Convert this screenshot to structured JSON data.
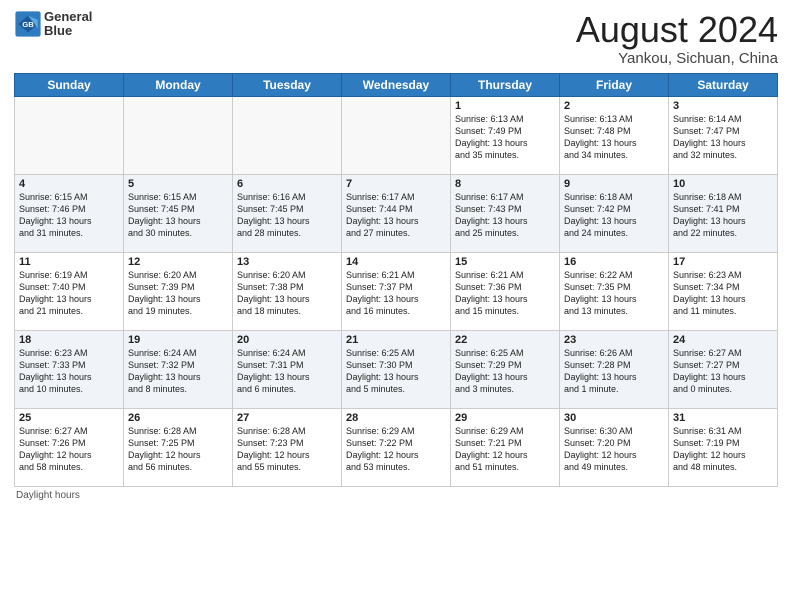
{
  "header": {
    "logo_line1": "General",
    "logo_line2": "Blue",
    "main_title": "August 2024",
    "subtitle": "Yankou, Sichuan, China"
  },
  "weekdays": [
    "Sunday",
    "Monday",
    "Tuesday",
    "Wednesday",
    "Thursday",
    "Friday",
    "Saturday"
  ],
  "weeks": [
    [
      {
        "day": "",
        "info": ""
      },
      {
        "day": "",
        "info": ""
      },
      {
        "day": "",
        "info": ""
      },
      {
        "day": "",
        "info": ""
      },
      {
        "day": "1",
        "info": "Sunrise: 6:13 AM\nSunset: 7:49 PM\nDaylight: 13 hours\nand 35 minutes."
      },
      {
        "day": "2",
        "info": "Sunrise: 6:13 AM\nSunset: 7:48 PM\nDaylight: 13 hours\nand 34 minutes."
      },
      {
        "day": "3",
        "info": "Sunrise: 6:14 AM\nSunset: 7:47 PM\nDaylight: 13 hours\nand 32 minutes."
      }
    ],
    [
      {
        "day": "4",
        "info": "Sunrise: 6:15 AM\nSunset: 7:46 PM\nDaylight: 13 hours\nand 31 minutes."
      },
      {
        "day": "5",
        "info": "Sunrise: 6:15 AM\nSunset: 7:45 PM\nDaylight: 13 hours\nand 30 minutes."
      },
      {
        "day": "6",
        "info": "Sunrise: 6:16 AM\nSunset: 7:45 PM\nDaylight: 13 hours\nand 28 minutes."
      },
      {
        "day": "7",
        "info": "Sunrise: 6:17 AM\nSunset: 7:44 PM\nDaylight: 13 hours\nand 27 minutes."
      },
      {
        "day": "8",
        "info": "Sunrise: 6:17 AM\nSunset: 7:43 PM\nDaylight: 13 hours\nand 25 minutes."
      },
      {
        "day": "9",
        "info": "Sunrise: 6:18 AM\nSunset: 7:42 PM\nDaylight: 13 hours\nand 24 minutes."
      },
      {
        "day": "10",
        "info": "Sunrise: 6:18 AM\nSunset: 7:41 PM\nDaylight: 13 hours\nand 22 minutes."
      }
    ],
    [
      {
        "day": "11",
        "info": "Sunrise: 6:19 AM\nSunset: 7:40 PM\nDaylight: 13 hours\nand 21 minutes."
      },
      {
        "day": "12",
        "info": "Sunrise: 6:20 AM\nSunset: 7:39 PM\nDaylight: 13 hours\nand 19 minutes."
      },
      {
        "day": "13",
        "info": "Sunrise: 6:20 AM\nSunset: 7:38 PM\nDaylight: 13 hours\nand 18 minutes."
      },
      {
        "day": "14",
        "info": "Sunrise: 6:21 AM\nSunset: 7:37 PM\nDaylight: 13 hours\nand 16 minutes."
      },
      {
        "day": "15",
        "info": "Sunrise: 6:21 AM\nSunset: 7:36 PM\nDaylight: 13 hours\nand 15 minutes."
      },
      {
        "day": "16",
        "info": "Sunrise: 6:22 AM\nSunset: 7:35 PM\nDaylight: 13 hours\nand 13 minutes."
      },
      {
        "day": "17",
        "info": "Sunrise: 6:23 AM\nSunset: 7:34 PM\nDaylight: 13 hours\nand 11 minutes."
      }
    ],
    [
      {
        "day": "18",
        "info": "Sunrise: 6:23 AM\nSunset: 7:33 PM\nDaylight: 13 hours\nand 10 minutes."
      },
      {
        "day": "19",
        "info": "Sunrise: 6:24 AM\nSunset: 7:32 PM\nDaylight: 13 hours\nand 8 minutes."
      },
      {
        "day": "20",
        "info": "Sunrise: 6:24 AM\nSunset: 7:31 PM\nDaylight: 13 hours\nand 6 minutes."
      },
      {
        "day": "21",
        "info": "Sunrise: 6:25 AM\nSunset: 7:30 PM\nDaylight: 13 hours\nand 5 minutes."
      },
      {
        "day": "22",
        "info": "Sunrise: 6:25 AM\nSunset: 7:29 PM\nDaylight: 13 hours\nand 3 minutes."
      },
      {
        "day": "23",
        "info": "Sunrise: 6:26 AM\nSunset: 7:28 PM\nDaylight: 13 hours\nand 1 minute."
      },
      {
        "day": "24",
        "info": "Sunrise: 6:27 AM\nSunset: 7:27 PM\nDaylight: 13 hours\nand 0 minutes."
      }
    ],
    [
      {
        "day": "25",
        "info": "Sunrise: 6:27 AM\nSunset: 7:26 PM\nDaylight: 12 hours\nand 58 minutes."
      },
      {
        "day": "26",
        "info": "Sunrise: 6:28 AM\nSunset: 7:25 PM\nDaylight: 12 hours\nand 56 minutes."
      },
      {
        "day": "27",
        "info": "Sunrise: 6:28 AM\nSunset: 7:23 PM\nDaylight: 12 hours\nand 55 minutes."
      },
      {
        "day": "28",
        "info": "Sunrise: 6:29 AM\nSunset: 7:22 PM\nDaylight: 12 hours\nand 53 minutes."
      },
      {
        "day": "29",
        "info": "Sunrise: 6:29 AM\nSunset: 7:21 PM\nDaylight: 12 hours\nand 51 minutes."
      },
      {
        "day": "30",
        "info": "Sunrise: 6:30 AM\nSunset: 7:20 PM\nDaylight: 12 hours\nand 49 minutes."
      },
      {
        "day": "31",
        "info": "Sunrise: 6:31 AM\nSunset: 7:19 PM\nDaylight: 12 hours\nand 48 minutes."
      }
    ]
  ],
  "footer": {
    "note": "Daylight hours"
  }
}
